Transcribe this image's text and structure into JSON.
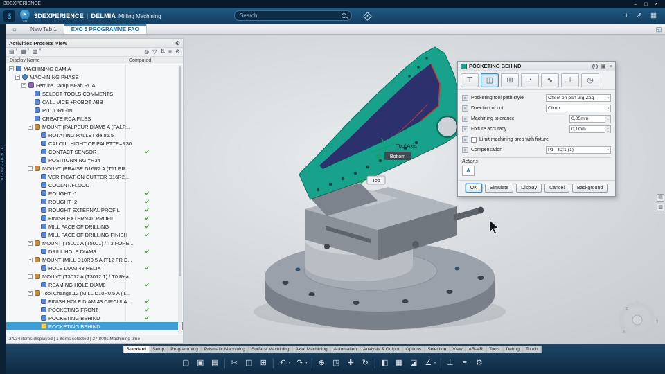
{
  "colors": {
    "accent_blue": "#3f9ed7",
    "check_green": "#3db22a",
    "part_teal": "#18a28c",
    "pocket_navy": "#2c306c",
    "highlight_red": "#d8302a"
  },
  "window": {
    "title": "3DEXPERIENCE",
    "controls": [
      {
        "name": "minimize-button",
        "glyph": "–"
      },
      {
        "name": "maximize-button",
        "glyph": "□"
      },
      {
        "name": "close-button",
        "glyph": "×"
      }
    ]
  },
  "header": {
    "brand": "3DEXPERIENCE",
    "divider": "|",
    "app": "DELMIA",
    "app_context": "Milling Machining",
    "play_glyph": "▶",
    "play_version": "V.R",
    "logo_glyph": "ʓ",
    "search": {
      "placeholder": "Search"
    },
    "right_icons": [
      {
        "name": "add-content-icon",
        "glyph": "+"
      },
      {
        "name": "share-icon",
        "glyph": "⇗"
      },
      {
        "name": "apps-icon",
        "glyph": "▦"
      }
    ]
  },
  "tabbar": {
    "home_glyph": "⌂",
    "expand_glyph": "◱",
    "tabs": [
      {
        "label": "New Tab 1",
        "active": false
      },
      {
        "label": "EXO 5 PROGRAMME FAO",
        "active": true
      }
    ]
  },
  "left_strip": {
    "vertical_text": "3DEXPERIENCE"
  },
  "tree_panel": {
    "title": "Activities Process View",
    "title_gear_glyph": "⚙",
    "toolbar_left": [
      {
        "name": "view-mode-icon",
        "glyph": "▤",
        "caret": true
      },
      {
        "name": "columns-view-icon",
        "glyph": "▦",
        "caret": true
      },
      {
        "name": "layout-view-icon",
        "glyph": "▥",
        "caret": true
      }
    ],
    "toolbar_right": [
      {
        "name": "search-icon",
        "glyph": "◎"
      },
      {
        "name": "filter-icon",
        "glyph": "▽"
      },
      {
        "name": "sort-icon",
        "glyph": "⇅"
      },
      {
        "name": "group-icon",
        "glyph": "≡"
      },
      {
        "name": "panel-settings-icon",
        "glyph": "⚙"
      }
    ],
    "columns": [
      "Display Name",
      "Computed"
    ],
    "rows": [
      {
        "label": "MACHINING CAM A",
        "indent": 0,
        "expander": true,
        "icon": "cam"
      },
      {
        "label": "MACHINING PHASE",
        "indent": 1,
        "expander": true,
        "icon": "phase"
      },
      {
        "label": "Ferrure CampusFab RCA",
        "indent": 2,
        "expander": true,
        "icon": "part"
      },
      {
        "label": "SELECT TOOLS COMMENTS",
        "indent": 3,
        "icon": "op"
      },
      {
        "label": "CALL VICE +ROBOT ABB",
        "indent": 3,
        "icon": "op"
      },
      {
        "label": "PUT ORIGIN",
        "indent": 3,
        "icon": "op"
      },
      {
        "label": "CREATE RCA FILES",
        "indent": 3,
        "icon": "op"
      },
      {
        "label": "MOUNT (PALPEUR DIAM5 A (PALP...",
        "indent": 3,
        "expander": true,
        "icon": "mount"
      },
      {
        "label": "ROTATING PALLET de 86.5",
        "indent": 4,
        "icon": "op"
      },
      {
        "label": "CALCUL HIGHT OF PALETTE=R30",
        "indent": 4,
        "icon": "op"
      },
      {
        "label": "CONTACT SENSOR",
        "indent": 4,
        "icon": "op",
        "computed": true
      },
      {
        "label": "POSITIONNING =R34",
        "indent": 4,
        "icon": "op"
      },
      {
        "label": "MOUNT (FRAISE D16R2 A (T11 FR...",
        "indent": 3,
        "expander": true,
        "icon": "mount"
      },
      {
        "label": "VERIFICATION CUTTER  D16R2...",
        "indent": 4,
        "icon": "op"
      },
      {
        "label": "COOLNT/FLOOD",
        "indent": 4,
        "icon": "op"
      },
      {
        "label": "ROUGHT -1",
        "indent": 4,
        "icon": "op",
        "computed": true
      },
      {
        "label": "ROUGHT -2",
        "indent": 4,
        "icon": "op",
        "computed": true
      },
      {
        "label": "ROUGHT EXTERNAL PROFIL",
        "indent": 4,
        "icon": "op",
        "computed": true
      },
      {
        "label": "FINISH EXTERNAL PROFIL",
        "indent": 4,
        "icon": "op",
        "computed": true
      },
      {
        "label": "MILL FACE OF DRILLING",
        "indent": 4,
        "icon": "op",
        "computed": true
      },
      {
        "label": "MILL FACE OF DRILLING FINISH",
        "indent": 4,
        "icon": "op",
        "computed": true
      },
      {
        "label": "MOUNT (T5001 A (T5001) / T3 FORE...",
        "indent": 3,
        "expander": true,
        "icon": "mount"
      },
      {
        "label": "DRILL HOLE DIAM8",
        "indent": 4,
        "icon": "op",
        "computed": true
      },
      {
        "label": "MOUNT (MILL D10R0.5 A (T12 FR D...",
        "indent": 3,
        "expander": true,
        "icon": "mount"
      },
      {
        "label": "HOLE DIAM 43 HELIX",
        "indent": 4,
        "icon": "op",
        "computed": true
      },
      {
        "label": "MOUNT (T3012 A (T3012.1) / T0 Rea...",
        "indent": 3,
        "expander": true,
        "icon": "mount"
      },
      {
        "label": "REAMING HOLE DIAM8",
        "indent": 4,
        "icon": "op",
        "computed": true
      },
      {
        "label": "Tool Change.12 (MILL D10R0.5 A (T...",
        "indent": 3,
        "expander": true,
        "icon": "mount"
      },
      {
        "label": "FINISH HOLE DIAM 43 CIRCULA...",
        "indent": 4,
        "icon": "op",
        "computed": true
      },
      {
        "label": "POCKETING FRONT",
        "indent": 4,
        "icon": "op",
        "computed": true
      },
      {
        "label": "POCKETING BEHIND",
        "indent": 4,
        "icon": "op",
        "computed": true
      },
      {
        "label": "POCKETING BEHIND",
        "indent": 4,
        "icon": "opsel",
        "selected": true
      }
    ],
    "status": "34/34 items displayed | 1 items selected | 27,808s Machining time"
  },
  "viewport": {
    "tool_axis_label": "Tool Axis",
    "bottom_label": "Bottom",
    "top_label": "Top",
    "compass": {
      "x": "x",
      "y": "y",
      "z": "z"
    }
  },
  "dialog": {
    "title": "POCKETING BEHIND",
    "title_icons": [
      {
        "name": "info-icon",
        "glyph": "i",
        "circ": true
      },
      {
        "name": "dock-icon",
        "glyph": "▣"
      },
      {
        "name": "close-icon",
        "glyph": "×"
      }
    ],
    "tabs": [
      {
        "name": "tool-tab-icon",
        "glyph": "⊤"
      },
      {
        "name": "geometry-tab-icon",
        "glyph": "◫",
        "selected": true
      },
      {
        "name": "strategy-tab-icon",
        "glyph": "⊞"
      },
      {
        "name": "feeds-speeds-tab-icon",
        "glyph": "◔"
      },
      {
        "name": "macro-tab-icon",
        "glyph": "∿"
      },
      {
        "name": "tool-axis-tab-icon",
        "glyph": "⊥"
      },
      {
        "name": "output-tab-icon",
        "glyph": "◷"
      }
    ],
    "fields": [
      {
        "type": "select",
        "label": "Pocketing tool path style",
        "value": "Offset on part Zig-Zag"
      },
      {
        "type": "select",
        "label": "Direction of cut",
        "value": "Climb"
      },
      {
        "type": "spin",
        "label": "Machining tolerance",
        "value": "0,05mm"
      },
      {
        "type": "spin",
        "label": "Fixture accuracy",
        "value": "0,1mm"
      },
      {
        "type": "checkbox",
        "label": "Limit machining area with fixture",
        "checked": false
      },
      {
        "type": "select",
        "label": "Compensation",
        "value": "P1 - ID:1 (1)"
      }
    ],
    "actions_label": "Actions",
    "actions_icon_glyph": "A",
    "buttons": [
      {
        "label": "OK",
        "primary": true
      },
      {
        "label": "Simulate"
      },
      {
        "label": "Display"
      },
      {
        "label": "Cancel"
      },
      {
        "label": "Background"
      }
    ]
  },
  "side_widgets": [
    {
      "name": "panel-toggle-top-icon",
      "glyph": "▤"
    },
    {
      "name": "panel-toggle-bottom-icon",
      "glyph": "▥"
    }
  ],
  "ribbon": {
    "tabs": [
      {
        "label": "Standard",
        "active": true
      },
      {
        "label": "Setup"
      },
      {
        "label": "Programming"
      },
      {
        "label": "Prismatic Machining"
      },
      {
        "label": "Surface Machining"
      },
      {
        "label": "Axial Machining"
      },
      {
        "label": "Automation"
      },
      {
        "label": "Analysis & Output"
      },
      {
        "label": "Options"
      },
      {
        "label": "Selection"
      },
      {
        "label": "View"
      },
      {
        "label": "AR-VR"
      },
      {
        "label": "Tools"
      },
      {
        "label": "Debug"
      },
      {
        "label": "Touch"
      }
    ],
    "toolbar": [
      {
        "name": "new-icon",
        "glyph": "▢"
      },
      {
        "name": "open-icon",
        "glyph": "▣"
      },
      {
        "name": "save-icon",
        "glyph": "▤"
      },
      {
        "name": "separator"
      },
      {
        "name": "cut-icon",
        "glyph": "✂"
      },
      {
        "name": "copy-icon",
        "glyph": "◫"
      },
      {
        "name": "paste-icon",
        "glyph": "⊞"
      },
      {
        "name": "separator"
      },
      {
        "name": "undo-icon",
        "glyph": "↶",
        "caret": true
      },
      {
        "name": "redo-icon",
        "glyph": "↷",
        "caret": true
      },
      {
        "name": "separator"
      },
      {
        "name": "zoom-icon",
        "glyph": "⊕"
      },
      {
        "name": "fit-all-icon",
        "glyph": "◳"
      },
      {
        "name": "pan-icon",
        "glyph": "✚"
      },
      {
        "name": "rotate-view-icon",
        "glyph": "↻"
      },
      {
        "name": "separator"
      },
      {
        "name": "shading-icon",
        "glyph": "◧"
      },
      {
        "name": "wireframe-icon",
        "glyph": "▦"
      },
      {
        "name": "section-icon",
        "glyph": "◪"
      },
      {
        "name": "measure-icon",
        "glyph": "∠",
        "caret": true
      },
      {
        "name": "separator"
      },
      {
        "name": "axis-system-icon",
        "glyph": "⊥"
      },
      {
        "name": "tree-toggle-icon",
        "glyph": "≡"
      },
      {
        "name": "toolbar-settings-icon",
        "glyph": "⚙"
      }
    ]
  }
}
